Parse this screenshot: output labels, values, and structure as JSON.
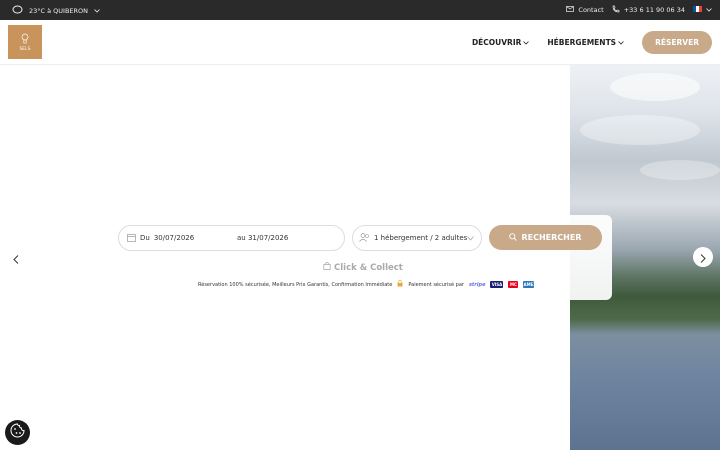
{
  "topbar": {
    "weather": "23°C à QUIBERON",
    "contact": "Contact",
    "phone": "+33 6 11 90 06 34",
    "language": "FR"
  },
  "header": {
    "logo_text": "SELS",
    "nav": [
      {
        "label": "DÉCOUVRIR"
      },
      {
        "label": "HÉBERGEMENTS"
      }
    ],
    "reserve_label": "RÉSERVER"
  },
  "search": {
    "from_label": "Du",
    "from_date": "30/07/2026",
    "to_label": "au",
    "to_date": "31/07/2026",
    "guests": "1 hébergement / 2 adultes",
    "button_label": "RECHERCHER",
    "click_collect": "Click & Collect",
    "guarantee": "Réservation 100% sécurisée, Meilleurs Prix Garantis, Confirmation Immédiate",
    "payment": "Paiement sécurisé par",
    "stripe": "stripe",
    "cards": [
      "VISA",
      "MC",
      "AMEX"
    ]
  },
  "colors": {
    "accent": "#c8a98a",
    "logo_bg": "#c9935c",
    "topbar_bg": "#2a2a2a"
  }
}
